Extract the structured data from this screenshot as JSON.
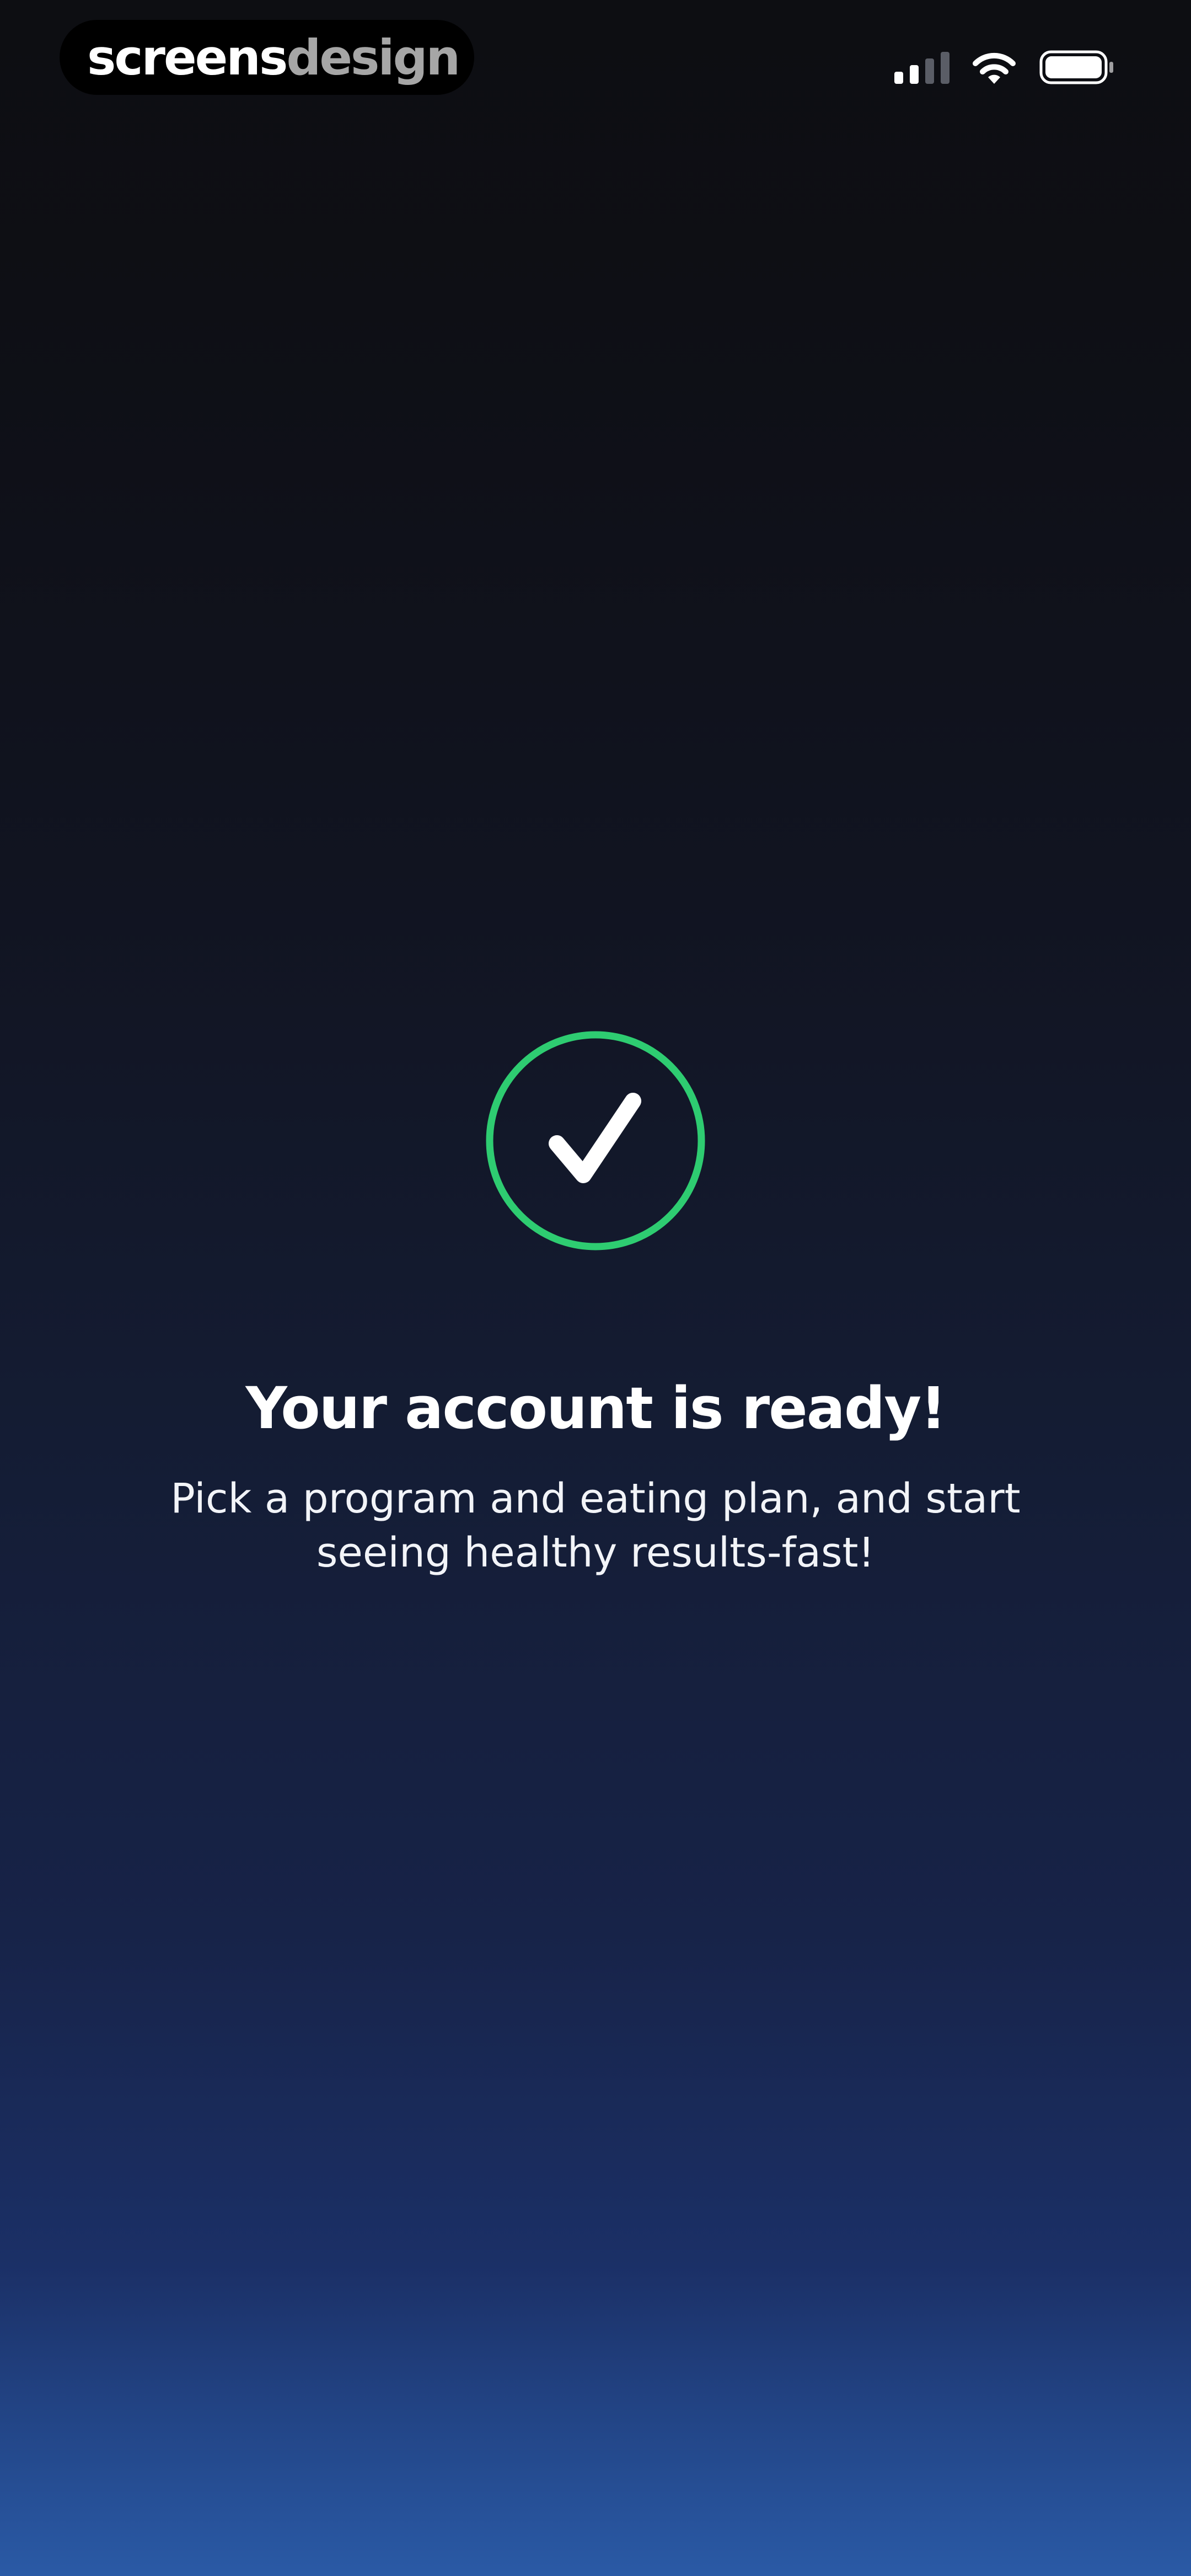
{
  "status_bar": {
    "brand_primary": "screens",
    "brand_secondary": "design",
    "signal_icon": "cellular-signal-icon",
    "wifi_icon": "wifi-icon",
    "battery_icon": "battery-icon"
  },
  "main": {
    "success_icon": "check-circle-icon",
    "accent_color": "#2ecc71",
    "title": "Your account is ready!",
    "subtitle": "Pick a program and eating plan, and start seeing healthy results-fast!"
  }
}
